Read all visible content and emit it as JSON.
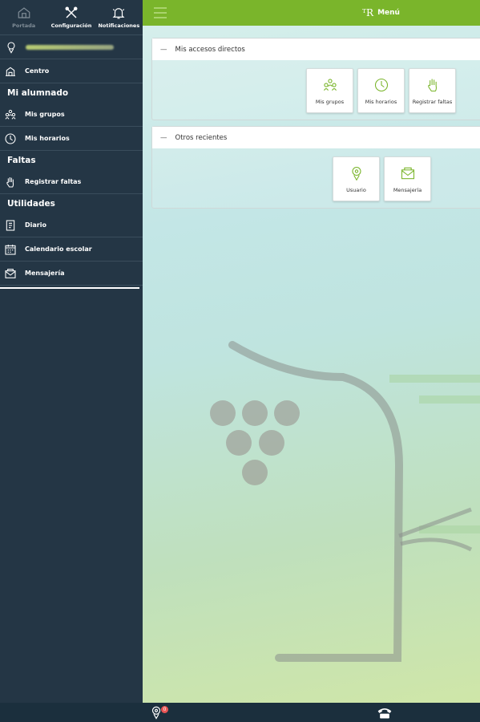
{
  "topnav": {
    "tabs": [
      {
        "label": "Portada",
        "icon": "home-icon"
      },
      {
        "label": "Configuración",
        "icon": "tools-icon"
      },
      {
        "label": "Notificaciones",
        "icon": "bell-icon"
      }
    ]
  },
  "sidebar": {
    "centro": "Centro",
    "sections": {
      "alumnado": "Mi alumnado",
      "faltas": "Faltas",
      "utilidades": "Utilidades"
    },
    "items": {
      "mis_grupos": "Mis grupos",
      "mis_horarios": "Mis horarios",
      "registrar_faltas": "Registrar faltas",
      "diario": "Diario",
      "calendario": "Calendario escolar",
      "mensajeria": "Mensajería"
    }
  },
  "header": {
    "logo": "ᵀR",
    "title": "Menú"
  },
  "panels": {
    "accesos": {
      "title": "Mis accesos directos",
      "tiles": [
        "Mis grupos",
        "Mis horarios",
        "Registrar faltas"
      ]
    },
    "recientes": {
      "title": "Otros recientes",
      "tiles": [
        "Usuario",
        "Mensajería"
      ]
    }
  },
  "bottombar": {
    "badge": "0"
  },
  "colors": {
    "header": "#7ab52b",
    "sidebar": "#243645",
    "accent": "#7ab52b"
  }
}
